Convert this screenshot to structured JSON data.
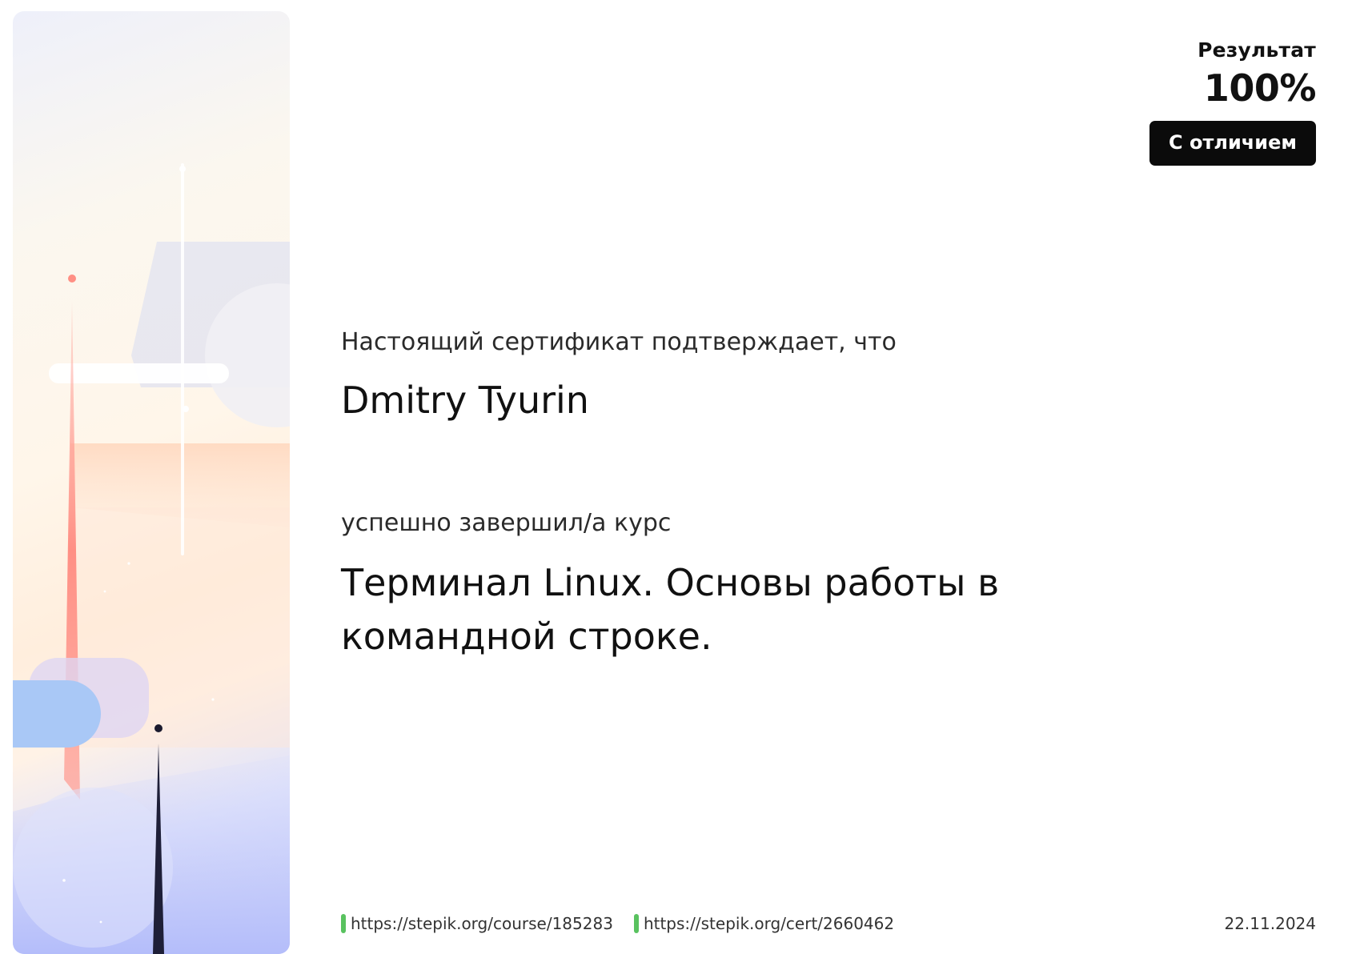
{
  "result": {
    "label": "Результат",
    "value": "100%",
    "badge": "С отличием"
  },
  "certificate": {
    "intro": "Настоящий сертификат подтверждает, что",
    "recipient": "Dmitry Tyurin",
    "completed_text": "успешно завершил/а  курс",
    "course_title": "Терминал Linux. Основы работы в командной строке."
  },
  "footer": {
    "course_url": "https://stepik.org/course/185283",
    "cert_url": "https://stepik.org/cert/2660462",
    "date": "22.11.2024"
  },
  "colors": {
    "badge_background": "#0b0b0b",
    "link_marker": "#59c25f",
    "accent_coral": "#ff8f84",
    "accent_blue": "#a9c8f6",
    "accent_lavender": "#b6befb"
  }
}
